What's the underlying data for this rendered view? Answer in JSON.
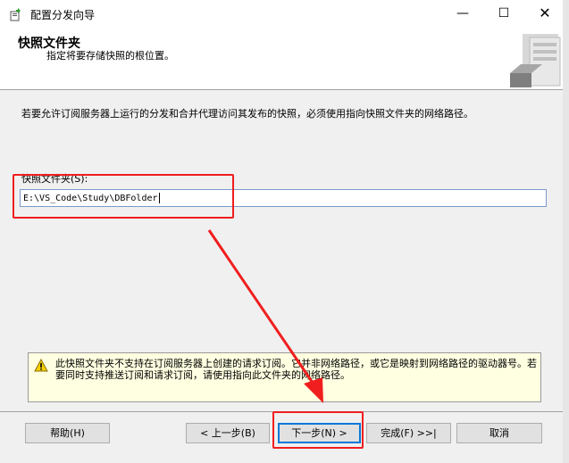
{
  "window": {
    "title": "配置分发向导",
    "minimize": "—",
    "maximize": "☐",
    "close": "✕"
  },
  "header": {
    "title": "快照文件夹",
    "subtitle": "指定将要存储快照的根位置。"
  },
  "body": {
    "description": "若要允许订阅服务器上运行的分发和合并代理访问其发布的快照，必须使用指向快照文件夹的网络路径。",
    "field_label": "快照文件夹(S):",
    "field_value": "E:\\VS_Code\\Study\\DBFolder"
  },
  "warning": {
    "text": "此快照文件夹不支持在订阅服务器上创建的请求订阅。它并非网络路径，或它是映射到网络路径的驱动器号。若要同时支持推送订阅和请求订阅，请使用指向此文件夹的网络路径。"
  },
  "buttons": {
    "help": "帮助(H)",
    "back": "< 上一步(B)",
    "next": "下一步(N) >",
    "finish": "完成(F) >>|",
    "cancel": "取消"
  },
  "colors": {
    "annotation": "#f01e1e",
    "warning_bg": "#ffffe1",
    "focus": "#0078d7"
  }
}
